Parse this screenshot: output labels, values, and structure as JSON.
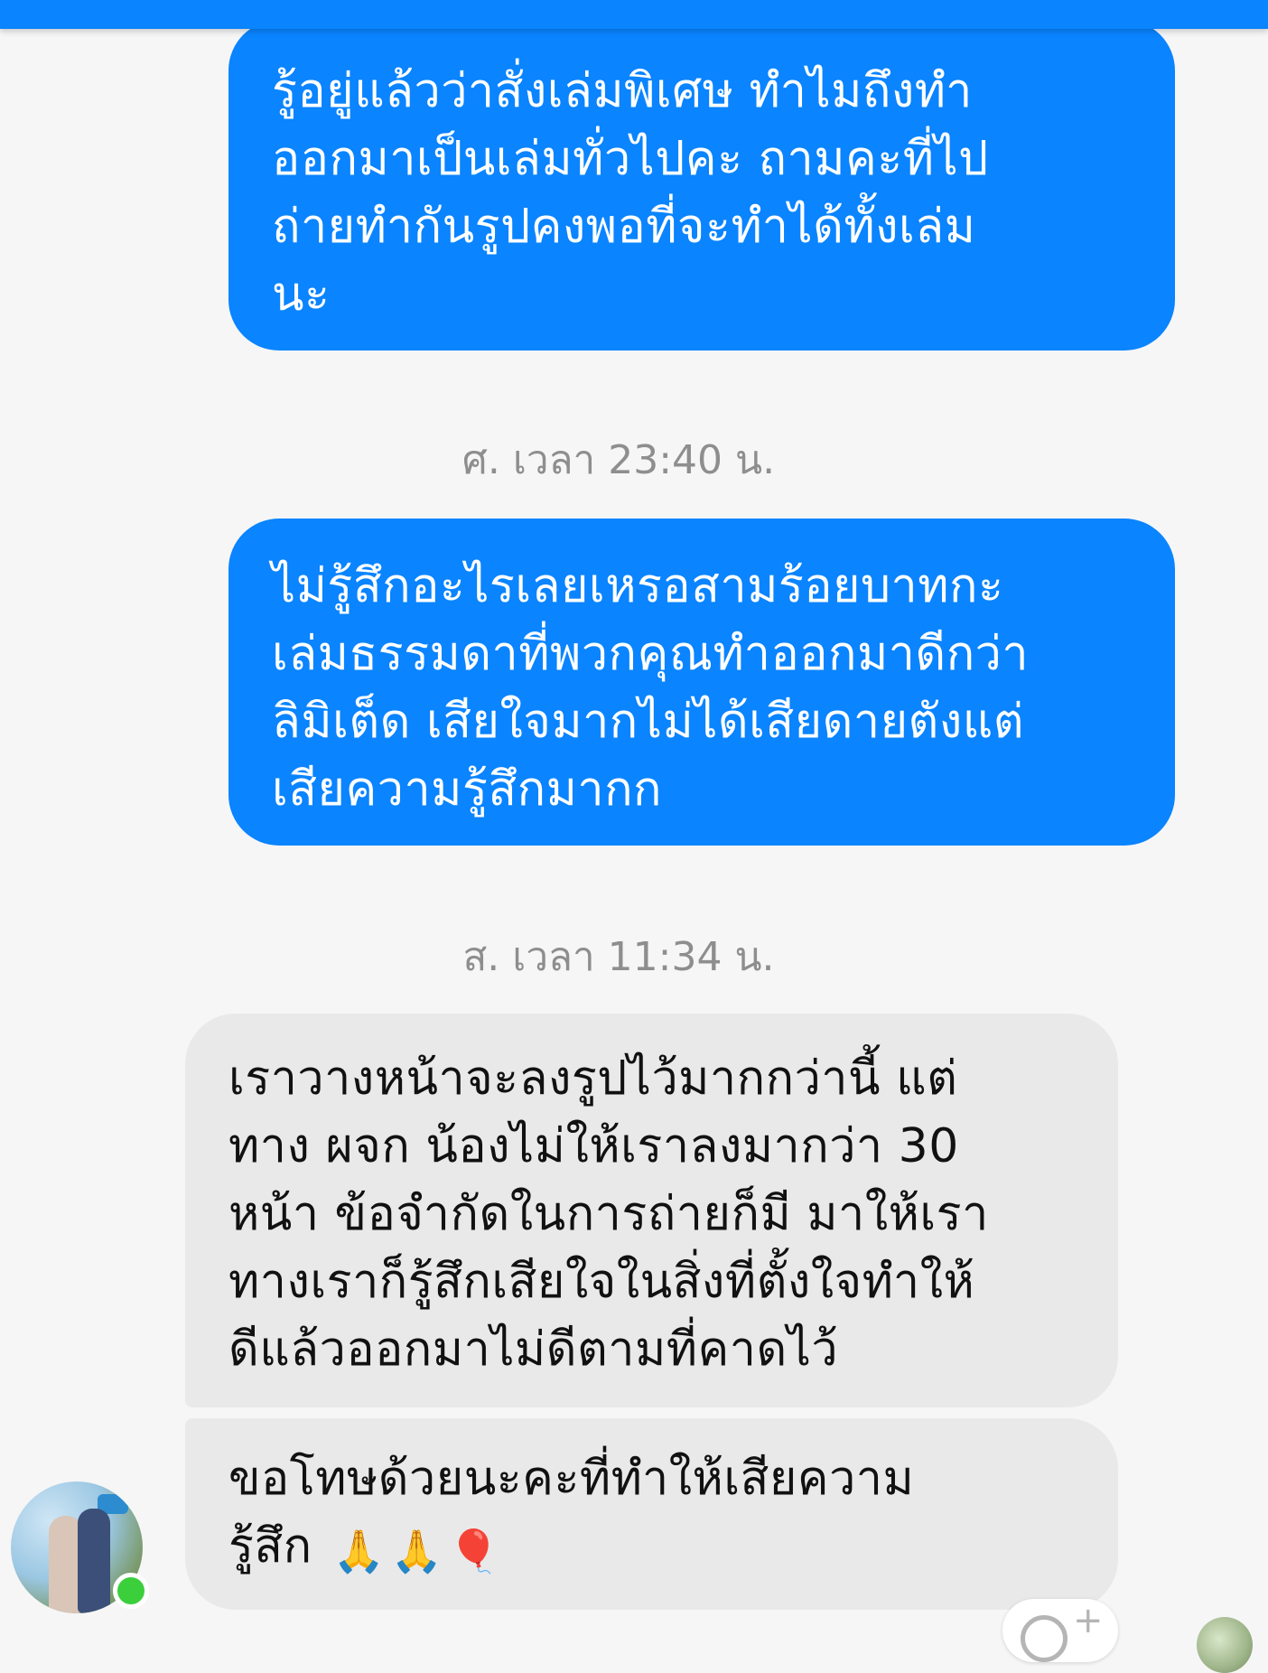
{
  "messages": [
    {
      "direction": "outgoing",
      "lines": [
        "รู้อยู่แล้วว่าสั่งเล่มพิเศษ ทำไมถึงทำ",
        "ออกมาเป็นเล่มทั่วไปคะ ถามคะที่ไป",
        "ถ่ายทำกันรูปคงพอที่จะทำได้ทั้งเล่ม",
        "นะ"
      ]
    },
    {
      "direction": "outgoing",
      "lines": [
        "ไม่รู้สึกอะไรเลยเหรอสามร้อยบาทกะ",
        "เล่มธรรมดาที่พวกคุณทำออกมาดีกว่า",
        "ลิมิเต็ด  เสียใจมากไม่ได้เสียดายตังแต่",
        "เสียความรู้สึกมากก"
      ]
    },
    {
      "direction": "incoming",
      "lines": [
        "เราวางหน้าจะลงรูปไว้มากกว่านี้ แต่",
        "ทาง ผจก น้องไม่ให้เราลงมากว่า 30",
        "หน้า ข้อจำกัดในการถ่ายก็มี มาให้เรา",
        "ทางเราก็รู้สึกเสียใจในสิ่งที่ตั้งใจทำให้",
        "ดีแล้วออกมาไม่ดีตามที่คาดไว้"
      ]
    },
    {
      "direction": "incoming",
      "lines": [
        "ขอโทษด้วยนะคะที่ทำให้เสียความ",
        "รู้สึก"
      ],
      "emoji": [
        "folded-hands",
        "folded-hands",
        "balloon"
      ],
      "emoji_glyphs": [
        "🙏",
        "🙏",
        "🎈"
      ]
    }
  ],
  "timestamps": [
    "ศ. เวลา 23:40 น.",
    "ส. เวลา 11:34 น."
  ],
  "colors": {
    "outgoing_bubble": "#0a84ff",
    "incoming_bubble": "#e9e9e9",
    "online_indicator": "#3ccf3c",
    "timestamp_text": "#8e8e8e"
  },
  "icons": {
    "online_status": "online-dot-icon",
    "add_reaction": "add-reaction-icon",
    "read_receipt": "read-receipt-avatar"
  }
}
